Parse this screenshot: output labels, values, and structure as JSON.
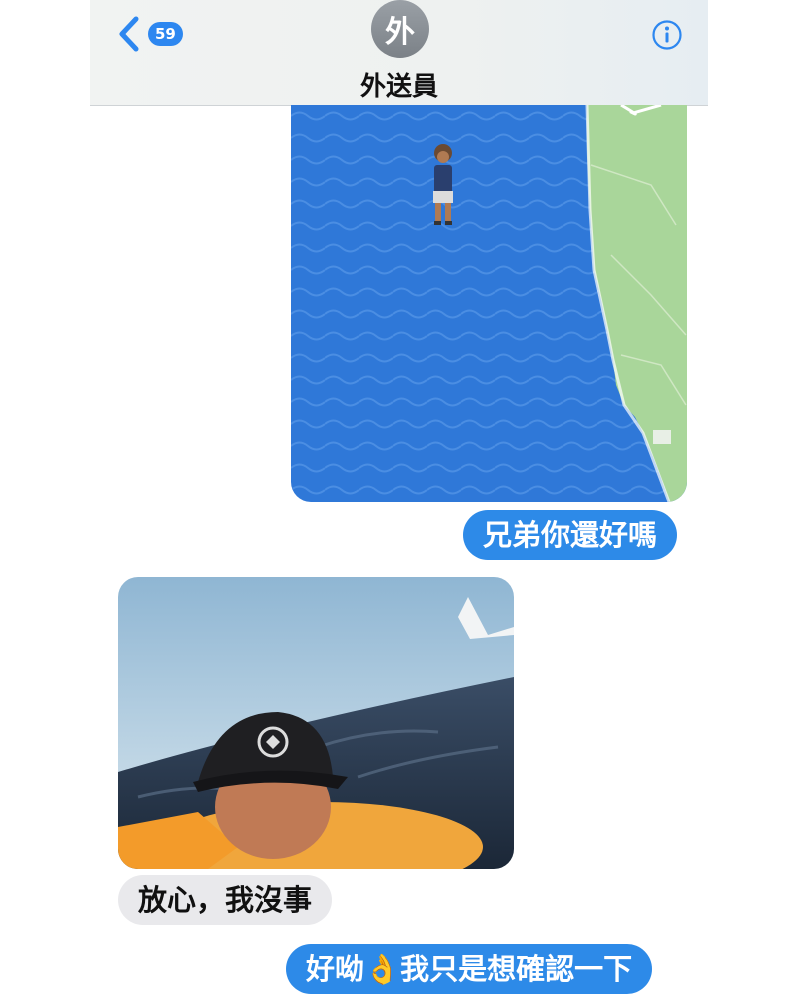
{
  "header": {
    "back_count": "59",
    "avatar_initial": "外",
    "contact_name": "外送員"
  },
  "messages": [
    {
      "id": "msg-map",
      "direction": "outgoing",
      "type": "image",
      "content": "map-location-in-ocean"
    },
    {
      "id": "msg-1",
      "direction": "outgoing",
      "type": "text",
      "text": "兄弟你還好嗎"
    },
    {
      "id": "msg-photo",
      "direction": "incoming",
      "type": "image",
      "content": "photo-man-floating-at-sea"
    },
    {
      "id": "msg-2",
      "direction": "incoming",
      "type": "text",
      "text": "放心，我沒事"
    },
    {
      "id": "msg-3",
      "direction": "outgoing",
      "type": "text",
      "text_before": "好呦",
      "emoji": "👌",
      "text_after": "我只是想確認一下"
    }
  ],
  "colors": {
    "outgoing_bubble": "#2d8ae8",
    "incoming_bubble": "#e9e9ec",
    "map_water": "#2f78d8",
    "map_land": "#a9d69a",
    "ios_blue": "#2d87f0"
  },
  "icons": [
    "back-chevron-icon",
    "info-icon"
  ]
}
